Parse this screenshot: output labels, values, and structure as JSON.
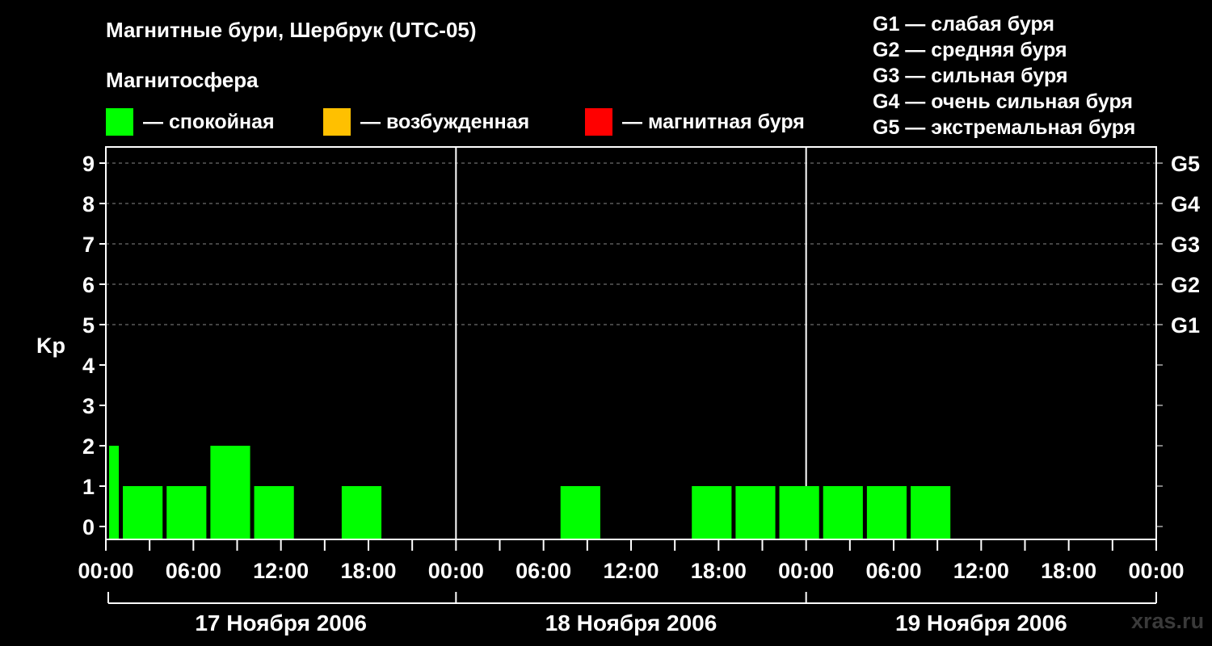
{
  "header": {
    "title": "Магнитные бури, Шербрук (UTC-05)",
    "subtitle": "Магнитосфера",
    "watermark": "xras.ru"
  },
  "legend": [
    {
      "label": "— спокойная",
      "color": "#00ff00"
    },
    {
      "label": "— возбужденная",
      "color": "#ffc000"
    },
    {
      "label": "— магнитная буря",
      "color": "#ff0000"
    }
  ],
  "storm_scale": [
    "G1 — слабая буря",
    "G2 — средняя буря",
    "G3 — сильная буря",
    "G4 — очень сильная буря",
    "G5 — экстремальная буря"
  ],
  "chart_data": {
    "type": "bar",
    "ylabel": "Kp",
    "ylim": [
      0,
      9
    ],
    "y_ticks": [
      "0",
      "1",
      "2",
      "3",
      "4",
      "5",
      "6",
      "7",
      "8",
      "9"
    ],
    "right_ticks": [
      {
        "kp": 5,
        "label": "G1"
      },
      {
        "kp": 6,
        "label": "G2"
      },
      {
        "kp": 7,
        "label": "G3"
      },
      {
        "kp": 8,
        "label": "G4"
      },
      {
        "kp": 9,
        "label": "G5"
      }
    ],
    "x_tick_labels": [
      "00:00",
      "06:00",
      "12:00",
      "18:00",
      "00:00",
      "06:00",
      "12:00",
      "18:00",
      "00:00",
      "06:00",
      "12:00",
      "18:00",
      "00:00"
    ],
    "days": [
      "17 Ноября 2006",
      "18 Ноября 2006",
      "19 Ноября 2006"
    ],
    "hours_total": 72,
    "grid": "dashed horizontal at Kp 5-9",
    "bar_color": "#00ff00",
    "bars": [
      {
        "start_hour": 0,
        "end_hour": 1,
        "kp": 2
      },
      {
        "start_hour": 1,
        "end_hour": 4,
        "kp": 1
      },
      {
        "start_hour": 4,
        "end_hour": 7,
        "kp": 1
      },
      {
        "start_hour": 7,
        "end_hour": 10,
        "kp": 2
      },
      {
        "start_hour": 10,
        "end_hour": 13,
        "kp": 1
      },
      {
        "start_hour": 13,
        "end_hour": 16,
        "kp": 0
      },
      {
        "start_hour": 16,
        "end_hour": 19,
        "kp": 1
      },
      {
        "start_hour": 19,
        "end_hour": 22,
        "kp": 0
      },
      {
        "start_hour": 22,
        "end_hour": 25,
        "kp": 0
      },
      {
        "start_hour": 25,
        "end_hour": 28,
        "kp": 0
      },
      {
        "start_hour": 28,
        "end_hour": 31,
        "kp": 0
      },
      {
        "start_hour": 31,
        "end_hour": 34,
        "kp": 1
      },
      {
        "start_hour": 34,
        "end_hour": 37,
        "kp": 0
      },
      {
        "start_hour": 37,
        "end_hour": 40,
        "kp": 0
      },
      {
        "start_hour": 40,
        "end_hour": 43,
        "kp": 1
      },
      {
        "start_hour": 43,
        "end_hour": 46,
        "kp": 1
      },
      {
        "start_hour": 46,
        "end_hour": 49,
        "kp": 1
      },
      {
        "start_hour": 49,
        "end_hour": 52,
        "kp": 1
      },
      {
        "start_hour": 52,
        "end_hour": 55,
        "kp": 1
      },
      {
        "start_hour": 55,
        "end_hour": 58,
        "kp": 1
      }
    ]
  }
}
